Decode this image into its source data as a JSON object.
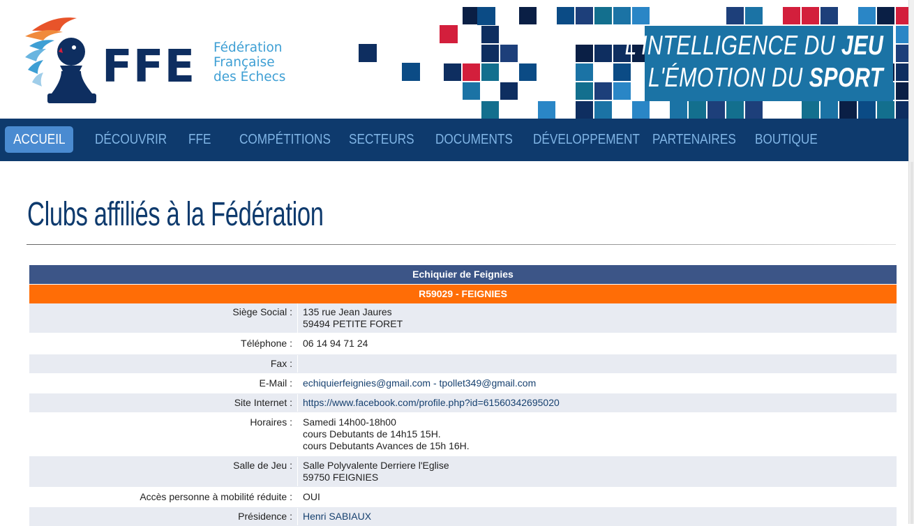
{
  "header": {
    "logo": {
      "acronym": "FFE",
      "name_lines": [
        "Fédération",
        "Française",
        "des Échecs"
      ]
    },
    "slogan": {
      "line1_prefix": "L'INTELLIGENCE DU ",
      "line1_bold": "JEU",
      "line2_prefix": "L'ÉMOTION DU ",
      "line2_bold": "SPORT"
    },
    "colors": {
      "navy": "#0e3a6d",
      "blue": "#1b73a5",
      "light_blue": "#3e9fd4",
      "red": "#d31f3c"
    }
  },
  "nav": {
    "items": [
      {
        "label": "ACCUEIL",
        "active": true
      },
      {
        "label": "DÉCOUVRIR"
      },
      {
        "label": "FFE"
      },
      {
        "label": "COMPÉTITIONS"
      },
      {
        "label": "SECTEURS"
      },
      {
        "label": "DOCUMENTS"
      },
      {
        "label": "DÉVELOPPEMENT"
      },
      {
        "label": "PARTENAIRES"
      },
      {
        "label": "BOUTIQUE"
      }
    ]
  },
  "page": {
    "title": "Clubs affiliés à la Fédération"
  },
  "club": {
    "name": "Echiquier de Feignies",
    "code": "R59029 - FEIGNIES",
    "rows": [
      {
        "label": "Siège Social :",
        "lines": [
          "135 rue Jean Jaures",
          "59494 PETITE FORET"
        ]
      },
      {
        "label": "Téléphone :",
        "lines": [
          "06 14 94 71 24"
        ]
      },
      {
        "label": "Fax :",
        "lines": [
          ""
        ]
      },
      {
        "label": "E-Mail :",
        "link": "echiquierfeignies@gmail.com - tpollet349@gmail.com"
      },
      {
        "label": "Site Internet :",
        "link": "https://www.facebook.com/profile.php?id=61560342695020"
      },
      {
        "label": "Horaires :",
        "lines": [
          "Samedi 14h00-18h00",
          "cours Debutants de 14h15 15H.",
          "cours Debutants Avances de 15h 16H."
        ]
      },
      {
        "label": "Salle de Jeu :",
        "lines": [
          "Salle Polyvalente Derriere l'Eglise",
          "59750 FEIGNIES"
        ]
      },
      {
        "label": "Accès personne à mobilité réduite :",
        "lines": [
          "OUI"
        ]
      },
      {
        "label": "Présidence :",
        "link": "Henri SABIAUX"
      }
    ]
  }
}
